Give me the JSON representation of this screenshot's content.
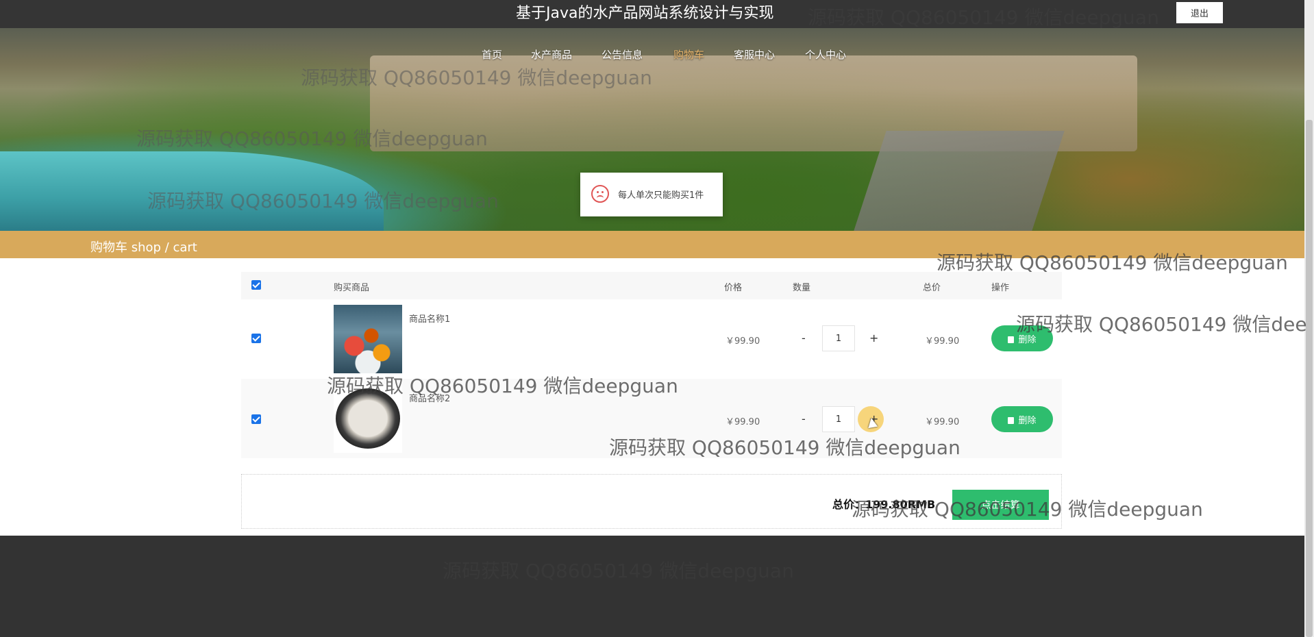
{
  "header": {
    "site_title": "基于Java的水产品网站系统设计与实现",
    "logout_label": "退出"
  },
  "nav": {
    "items": [
      "首页",
      "水产商品",
      "公告信息",
      "购物车",
      "客服中心",
      "个人中心"
    ],
    "active": "购物车"
  },
  "toast": {
    "icon": "sad-face-icon",
    "message": "每人单次只能购买1件"
  },
  "breadcrumb": {
    "text": "购物车  shop / cart"
  },
  "cart": {
    "headers": {
      "product": "购买商品",
      "price": "价格",
      "quantity": "数量",
      "total": "总价",
      "action": "操作"
    },
    "select_all_checked": true,
    "rows": [
      {
        "name": "商品名称1",
        "price": "￥99.90",
        "quantity": "1",
        "total": "￥99.90",
        "delete_label": "删除",
        "checked": true,
        "image": "seafood-platter"
      },
      {
        "name": "商品名称2",
        "price": "￥99.90",
        "quantity": "1",
        "total": "￥99.90",
        "delete_label": "删除",
        "checked": true,
        "image": "shrimp-plate"
      }
    ],
    "minus_label": "-",
    "plus_label": "+"
  },
  "summary": {
    "total_text": "总价：199.80RMB",
    "checkout_label": "点击结算"
  },
  "watermark": "源码获取 QQ86050149 微信deepguan",
  "watermark_partial": "源码获取 QQ86050149 微信dee",
  "colors": {
    "accent_green": "#2ebd6e",
    "breadcrumb_gold": "#d8a95b",
    "nav_active": "#e6b36a",
    "topbar": "#353535",
    "footer": "#333333"
  }
}
